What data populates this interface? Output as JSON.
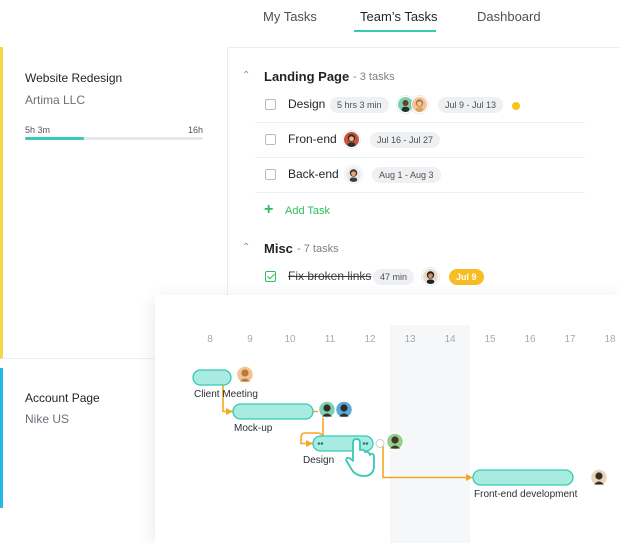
{
  "tabs": [
    {
      "label": "My Tasks",
      "active": false
    },
    {
      "label": "Team’s Tasks",
      "active": true
    },
    {
      "label": "Dashboard",
      "active": false
    }
  ],
  "projects": [
    {
      "name": "Website Redesign",
      "client": "Artima LLC",
      "tracked": "5h 3m",
      "estimate": "16h",
      "progress": 0.33,
      "color": "#f6d64a"
    },
    {
      "name": "Account Page",
      "client": "Nike US",
      "color": "#29b6ea"
    }
  ],
  "groups": [
    {
      "title": "Landing Page",
      "count": "- 3 tasks",
      "tasks": [
        {
          "name": "Design",
          "time": "5 hrs 3 min",
          "dates": "Jul 9 - Jul 13",
          "done": false,
          "status_color": "#f5c518"
        },
        {
          "name": "Fron-end",
          "dates": "Jul 16 - Jul 27",
          "done": false
        },
        {
          "name": "Back-end",
          "dates": "Aug 1 - Aug 3",
          "done": false
        }
      ],
      "add_label": "Add Task"
    },
    {
      "title": "Misc",
      "count": "- 7 tasks",
      "tasks": [
        {
          "name": "Fix broken links",
          "time": "47 min",
          "dates": "Jul 9",
          "done": true
        }
      ]
    }
  ],
  "colors": {
    "accent": "#36c9b4",
    "bar_fill": "#a8ebe0",
    "connector": "#f5a623",
    "done_green": "#2fbf5a",
    "highlight_yellow": "#f7bd25"
  },
  "chart_data": {
    "type": "gantt",
    "days": [
      8,
      9,
      10,
      11,
      12,
      13,
      14,
      15,
      16,
      17,
      18
    ],
    "weekend_days": [
      13,
      14
    ],
    "tasks": [
      {
        "name": "Client Meeting",
        "start": 8,
        "end": 8.95,
        "avatars": 1
      },
      {
        "name": "Mock-up",
        "start": 9,
        "end": 11,
        "avatars": 2
      },
      {
        "name": "Design",
        "start": 11,
        "end": 12.5,
        "avatars": 1,
        "selected": true
      },
      {
        "name": "Front-end development",
        "start": 15,
        "end": 17.5,
        "avatars": 1
      }
    ],
    "links": [
      [
        0,
        1
      ],
      [
        1,
        2
      ],
      [
        2,
        3
      ]
    ]
  }
}
